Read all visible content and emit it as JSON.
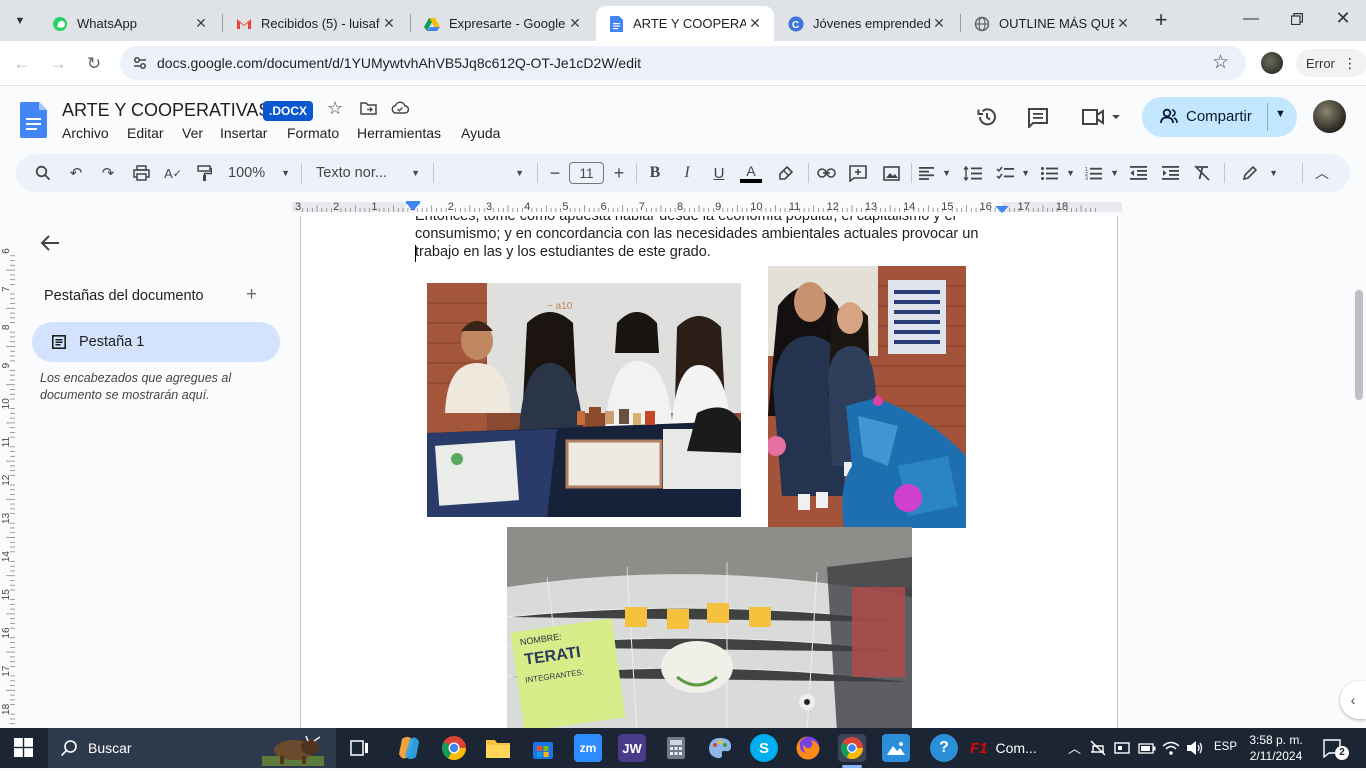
{
  "browser": {
    "tabs": [
      {
        "title": "WhatsApp",
        "icon": "whatsapp-icon",
        "active": false
      },
      {
        "title": "Recibidos (5) - luisafe",
        "icon": "gmail-icon",
        "active": false
      },
      {
        "title": "Expresarte - Google D",
        "icon": "google-drive-icon",
        "active": false
      },
      {
        "title": "ARTE Y COOPERATIVA",
        "icon": "google-docs-icon",
        "active": true
      },
      {
        "title": "Jóvenes emprendedo",
        "icon": "canva-icon",
        "active": false
      },
      {
        "title": "OUTLINE MÁS QUE P",
        "icon": "globe-icon",
        "active": false
      }
    ],
    "url": "docs.google.com/document/d/1YUMywtvhAhVB5Jq8c612Q-OT-Je1cD2W/edit",
    "profile_label": "Error"
  },
  "docs": {
    "title": "ARTE Y COOPERATIVAS",
    "badge": ".DOCX",
    "menu": [
      "Archivo",
      "Editar",
      "Ver",
      "Insertar",
      "Formato",
      "Herramientas",
      "Ayuda"
    ],
    "share_label": "Compartir",
    "toolbar": {
      "zoom": "100%",
      "style": "Texto nor...",
      "font_size": "11"
    },
    "ruler_numbers": [
      "3",
      "2",
      "1",
      "1",
      "2",
      "3",
      "4",
      "5",
      "6",
      "7",
      "8",
      "9",
      "10",
      "11",
      "12",
      "13",
      "14",
      "15",
      "16",
      "17",
      "18"
    ],
    "vruler_numbers": [
      "6",
      "7",
      "8",
      "9",
      "10",
      "11",
      "12",
      "13",
      "14",
      "15",
      "16",
      "17",
      "18"
    ]
  },
  "sidebar": {
    "heading": "Pestañas del documento",
    "tab_label": "Pestaña 1",
    "hint": "Los encabezados que agregues al documento se mostrarán aquí."
  },
  "document": {
    "lines": [
      "Entonces, tomé como apuesta hablar desde la economía popular, el capitalismo y el",
      "consumismo; y en concordancia con las necesidades ambientales actuales provocar un",
      "trabajo en las y los estudiantes de este grado."
    ],
    "photo_texts": {
      "sign_line1": "NOMBRE:",
      "sign_line2": "TERATI",
      "sign_line3": "INTEGRANTES:"
    }
  },
  "taskbar": {
    "search_placeholder": "Buscar",
    "active_app_label": "Com...",
    "language": "ESP",
    "time": "3:58 p. m.",
    "date": "2/11/2024",
    "notifications": "2"
  }
}
